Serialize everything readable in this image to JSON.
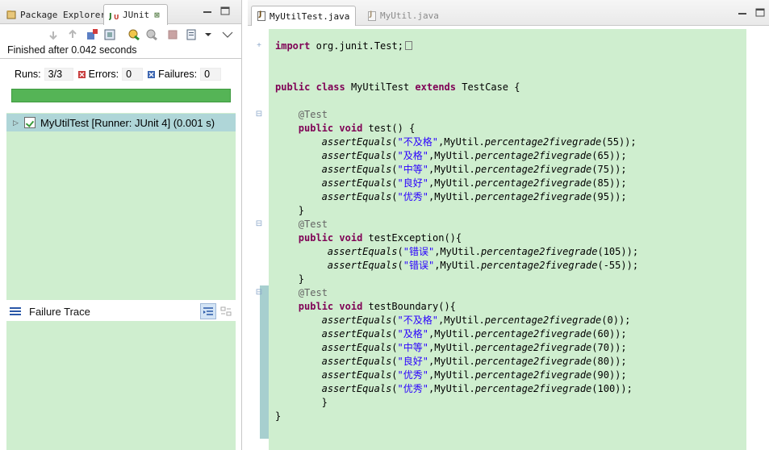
{
  "left_panel": {
    "tabs": [
      {
        "label": "Package Explorer",
        "icon": "package-explorer-icon"
      },
      {
        "label": "JUnit",
        "icon": "junit-icon",
        "close_glyph": "⊠"
      }
    ],
    "status": "Finished after 0.042 seconds",
    "counters": {
      "runs_label": "Runs:",
      "runs_value": "3/3",
      "errors_label": "Errors:",
      "errors_value": "0",
      "failures_label": "Failures:",
      "failures_value": "0"
    },
    "progress_fraction": 1.0,
    "progress_color": "#55b456",
    "tree": [
      {
        "label": "MyUtilTest [Runner: JUnit 4] (0.001 s)",
        "icon": "test-suite-success-icon"
      }
    ],
    "failure_trace_title": "Failure Trace"
  },
  "editor": {
    "tabs": [
      {
        "label": "MyUtilTest.java",
        "active": true
      },
      {
        "label": "MyUtil.java",
        "active": false
      }
    ],
    "lines": [
      {
        "row": 0,
        "indent": 0,
        "fold": "+",
        "spans": [
          {
            "t": "import",
            "c": "kw"
          },
          {
            "t": " org.junit.Test;"
          }
        ],
        "folded_marker": true
      },
      {
        "row": 3,
        "indent": 0,
        "spans": [
          {
            "t": "public",
            "c": "kw"
          },
          {
            "t": " "
          },
          {
            "t": "class",
            "c": "kw"
          },
          {
            "t": " MyUtilTest "
          },
          {
            "t": "extends",
            "c": "kw"
          },
          {
            "t": " TestCase {"
          }
        ]
      },
      {
        "row": 5,
        "indent": 4,
        "fold": "-",
        "spans": [
          {
            "t": "@Test",
            "c": "ann"
          }
        ]
      },
      {
        "row": 6,
        "indent": 4,
        "spans": [
          {
            "t": "public",
            "c": "kw"
          },
          {
            "t": " "
          },
          {
            "t": "void",
            "c": "kw"
          },
          {
            "t": " test() {"
          }
        ]
      },
      {
        "row": 7,
        "indent": 8,
        "spans": [
          {
            "t": "assertEquals",
            "c": "it"
          },
          {
            "t": "("
          },
          {
            "t": "\"不及格\"",
            "c": "str"
          },
          {
            "t": ",MyUtil."
          },
          {
            "t": "percentage2fivegrade",
            "c": "it"
          },
          {
            "t": "(55));"
          }
        ]
      },
      {
        "row": 8,
        "indent": 8,
        "spans": [
          {
            "t": "assertEquals",
            "c": "it"
          },
          {
            "t": "("
          },
          {
            "t": "\"及格\"",
            "c": "str"
          },
          {
            "t": ",MyUtil."
          },
          {
            "t": "percentage2fivegrade",
            "c": "it"
          },
          {
            "t": "(65));"
          }
        ]
      },
      {
        "row": 9,
        "indent": 8,
        "spans": [
          {
            "t": "assertEquals",
            "c": "it"
          },
          {
            "t": "("
          },
          {
            "t": "\"中等\"",
            "c": "str"
          },
          {
            "t": ",MyUtil."
          },
          {
            "t": "percentage2fivegrade",
            "c": "it"
          },
          {
            "t": "(75));"
          }
        ]
      },
      {
        "row": 10,
        "indent": 8,
        "spans": [
          {
            "t": "assertEquals",
            "c": "it"
          },
          {
            "t": "("
          },
          {
            "t": "\"良好\"",
            "c": "str"
          },
          {
            "t": ",MyUtil."
          },
          {
            "t": "percentage2fivegrade",
            "c": "it"
          },
          {
            "t": "(85));"
          }
        ]
      },
      {
        "row": 11,
        "indent": 8,
        "spans": [
          {
            "t": "assertEquals",
            "c": "it"
          },
          {
            "t": "("
          },
          {
            "t": "\"优秀\"",
            "c": "str"
          },
          {
            "t": ",MyUtil."
          },
          {
            "t": "percentage2fivegrade",
            "c": "it"
          },
          {
            "t": "(95));"
          }
        ]
      },
      {
        "row": 12,
        "indent": 4,
        "spans": [
          {
            "t": "}"
          }
        ]
      },
      {
        "row": 13,
        "indent": 4,
        "fold": "-",
        "spans": [
          {
            "t": "@Test",
            "c": "ann"
          }
        ]
      },
      {
        "row": 14,
        "indent": 4,
        "spans": [
          {
            "t": "public",
            "c": "kw"
          },
          {
            "t": " "
          },
          {
            "t": "void",
            "c": "kw"
          },
          {
            "t": " testException(){"
          }
        ]
      },
      {
        "row": 15,
        "indent": 9,
        "spans": [
          {
            "t": "assertEquals",
            "c": "it"
          },
          {
            "t": "("
          },
          {
            "t": "\"错误\"",
            "c": "str"
          },
          {
            "t": ",MyUtil."
          },
          {
            "t": "percentage2fivegrade",
            "c": "it"
          },
          {
            "t": "(105));"
          }
        ]
      },
      {
        "row": 16,
        "indent": 9,
        "spans": [
          {
            "t": "assertEquals",
            "c": "it"
          },
          {
            "t": "("
          },
          {
            "t": "\"错误\"",
            "c": "str"
          },
          {
            "t": ",MyUtil."
          },
          {
            "t": "percentage2fivegrade",
            "c": "it"
          },
          {
            "t": "(-55));"
          }
        ]
      },
      {
        "row": 17,
        "indent": 4,
        "spans": [
          {
            "t": "}"
          }
        ]
      },
      {
        "row": 18,
        "indent": 4,
        "fold": "-",
        "spans": [
          {
            "t": "@Test",
            "c": "ann"
          }
        ]
      },
      {
        "row": 19,
        "indent": 4,
        "spans": [
          {
            "t": "public",
            "c": "kw"
          },
          {
            "t": " "
          },
          {
            "t": "void",
            "c": "kw"
          },
          {
            "t": " testBoundary(){"
          }
        ]
      },
      {
        "row": 20,
        "indent": 8,
        "spans": [
          {
            "t": "assertEquals",
            "c": "it"
          },
          {
            "t": "("
          },
          {
            "t": "\"不及格\"",
            "c": "str"
          },
          {
            "t": ",MyUtil."
          },
          {
            "t": "percentage2fivegrade",
            "c": "it"
          },
          {
            "t": "(0));"
          }
        ]
      },
      {
        "row": 21,
        "indent": 8,
        "spans": [
          {
            "t": "assertEquals",
            "c": "it"
          },
          {
            "t": "("
          },
          {
            "t": "\"及格\"",
            "c": "str"
          },
          {
            "t": ",MyUtil."
          },
          {
            "t": "percentage2fivegrade",
            "c": "it"
          },
          {
            "t": "(60));"
          }
        ]
      },
      {
        "row": 22,
        "indent": 8,
        "spans": [
          {
            "t": "assertEquals",
            "c": "it"
          },
          {
            "t": "("
          },
          {
            "t": "\"中等\"",
            "c": "str"
          },
          {
            "t": ",MyUtil."
          },
          {
            "t": "percentage2fivegrade",
            "c": "it"
          },
          {
            "t": "(70));"
          }
        ]
      },
      {
        "row": 23,
        "indent": 8,
        "spans": [
          {
            "t": "assertEquals",
            "c": "it"
          },
          {
            "t": "("
          },
          {
            "t": "\"良好\"",
            "c": "str"
          },
          {
            "t": ",MyUtil."
          },
          {
            "t": "percentage2fivegrade",
            "c": "it"
          },
          {
            "t": "(80));"
          }
        ]
      },
      {
        "row": 24,
        "indent": 8,
        "spans": [
          {
            "t": "assertEquals",
            "c": "it"
          },
          {
            "t": "("
          },
          {
            "t": "\"优秀\"",
            "c": "str"
          },
          {
            "t": ",MyUtil."
          },
          {
            "t": "percentage2fivegrade",
            "c": "it"
          },
          {
            "t": "(90));"
          }
        ]
      },
      {
        "row": 25,
        "indent": 8,
        "spans": [
          {
            "t": "assertEquals",
            "c": "it"
          },
          {
            "t": "("
          },
          {
            "t": "\"优秀\"",
            "c": "str"
          },
          {
            "t": ",MyUtil."
          },
          {
            "t": "percentage2fivegrade",
            "c": "it"
          },
          {
            "t": "(100));"
          }
        ]
      },
      {
        "row": 26,
        "indent": 8,
        "spans": [
          {
            "t": "}"
          }
        ]
      },
      {
        "row": 27,
        "indent": 0,
        "spans": [
          {
            "t": "}"
          }
        ]
      }
    ]
  },
  "colors": {
    "test_background": "#cfeecf",
    "keyword": "#7f0055",
    "string": "#2a00ff",
    "annotation": "#646464",
    "selection": "#afd6d8"
  }
}
